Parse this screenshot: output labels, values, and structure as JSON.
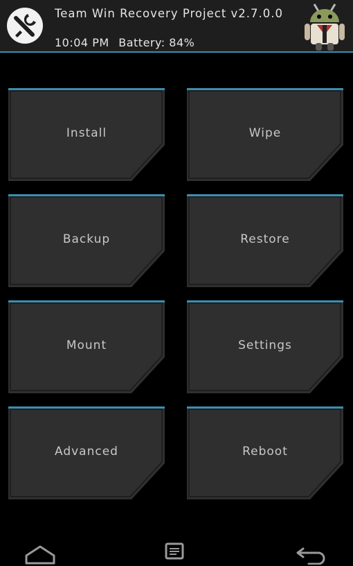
{
  "header": {
    "title": "Team Win Recovery Project  v2.7.0.0",
    "time": "10:04 PM",
    "battery": "Battery: 84%"
  },
  "accent_color": "#3a8fb0",
  "tile_color": "#2f2f2f",
  "tiles": [
    {
      "label": "Install"
    },
    {
      "label": "Wipe"
    },
    {
      "label": "Backup"
    },
    {
      "label": "Restore"
    },
    {
      "label": "Mount"
    },
    {
      "label": "Settings"
    },
    {
      "label": "Advanced"
    },
    {
      "label": "Reboot"
    }
  ],
  "navbar": {
    "home_icon": "home-icon",
    "console_icon": "console-icon",
    "back_icon": "back-arrow-icon"
  }
}
